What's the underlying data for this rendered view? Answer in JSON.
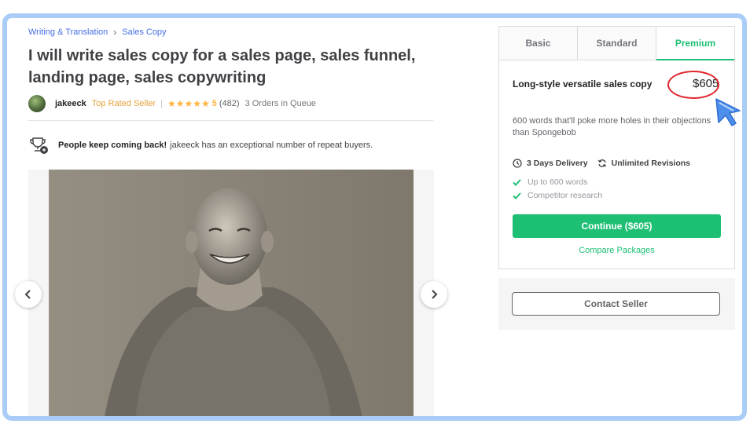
{
  "breadcrumb": {
    "category": "Writing & Translation",
    "subcategory": "Sales Copy"
  },
  "gig": {
    "title": "I will write sales copy for a sales page, sales funnel, landing page, sales copywriting"
  },
  "seller": {
    "name": "jakeeck",
    "level": "Top Rated Seller",
    "rating": "5",
    "review_count": "(482)",
    "queue": "3 Orders in Queue",
    "avatar_icon": "avatar"
  },
  "repeat_buyers": {
    "bold": "People keep coming back!",
    "text": "jakeeck has an exceptional number of repeat buyers.",
    "icon": "trophy-icon"
  },
  "gallery": {
    "prev_icon": "chevron-left-icon",
    "next_icon": "chevron-right-icon"
  },
  "packages": {
    "tabs": [
      "Basic",
      "Standard",
      "Premium"
    ],
    "active_tab": "Premium",
    "title": "Long-style versatile sales copy",
    "price": "$605",
    "description": "600 words that'll poke more holes in their objections than Spongebob",
    "delivery": "3 Days Delivery",
    "revisions": "Unlimited Revisions",
    "features": [
      "Up to 600 words",
      "Competitor research"
    ],
    "continue_label": "Continue ($605)",
    "compare_label": "Compare Packages"
  },
  "contact": {
    "label": "Contact Seller"
  },
  "colors": {
    "accent_green": "#1dbf73",
    "link_blue": "#446ee7",
    "star_yellow": "#ffb33e",
    "highlight_red": "#e0242b",
    "frame_blue": "#a9cdf6"
  }
}
